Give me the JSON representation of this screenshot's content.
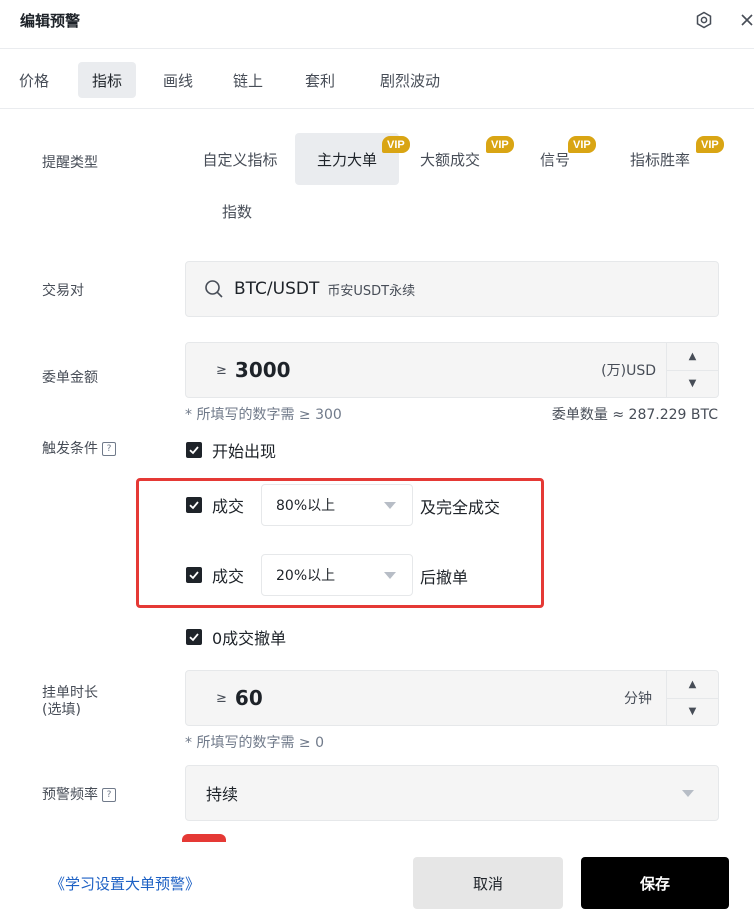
{
  "header": {
    "title": "编辑预警",
    "settings_icon": "gear-circle-icon",
    "close_icon": "close-icon"
  },
  "tabs": [
    {
      "label": "价格",
      "active": false
    },
    {
      "label": "指标",
      "active": true
    },
    {
      "label": "画线",
      "active": false
    },
    {
      "label": "链上",
      "active": false
    },
    {
      "label": "套利",
      "active": false
    },
    {
      "label": "剧烈波动",
      "active": false
    }
  ],
  "alert_type": {
    "label": "提醒类型",
    "options": [
      {
        "label": "自定义指标",
        "vip": false,
        "active": false
      },
      {
        "label": "主力大单",
        "vip": true,
        "active": true
      },
      {
        "label": "大额成交",
        "vip": true,
        "active": false
      },
      {
        "label": "信号",
        "vip": true,
        "active": false
      },
      {
        "label": "指标胜率",
        "vip": true,
        "active": false
      },
      {
        "label": "指数",
        "vip": false,
        "active": false
      }
    ],
    "vip_text": "VIP"
  },
  "pair": {
    "label": "交易对",
    "symbol": "BTC/USDT",
    "market": "币安USDT永续"
  },
  "order_amount": {
    "label": "委单金额",
    "prefix": "≥",
    "value": "3000",
    "unit": "(万)USD",
    "hint": "* 所填写的数字需 ≥ 300",
    "quantity_hint": "委单数量 ≈ 287.229 BTC"
  },
  "trigger": {
    "label": "触发条件",
    "help": "?",
    "start": {
      "label": "开始出现",
      "checked": true
    },
    "fill_full": {
      "prefix": "成交",
      "selected": "80%以上",
      "suffix": "及完全成交",
      "checked": true
    },
    "fill_cancel": {
      "prefix": "成交",
      "selected": "20%以上",
      "suffix": "后撤单",
      "checked": true
    },
    "zero_cancel": {
      "label": "0成交撤单",
      "checked": true
    }
  },
  "duration": {
    "label_line1": "挂单时长",
    "label_line2": "(选填)",
    "prefix": "≥",
    "value": "60",
    "unit": "分钟",
    "hint": "* 所填写的数字需 ≥ 0"
  },
  "frequency": {
    "label": "预警频率",
    "help": "?",
    "selected": "持续"
  },
  "footer": {
    "learn_link": "《学习设置大单预警》",
    "cancel": "取消",
    "save": "保存"
  },
  "colors": {
    "vip": "#d9a514",
    "highlight": "#e53935",
    "primary": "#000000",
    "link": "#1c60c4"
  }
}
